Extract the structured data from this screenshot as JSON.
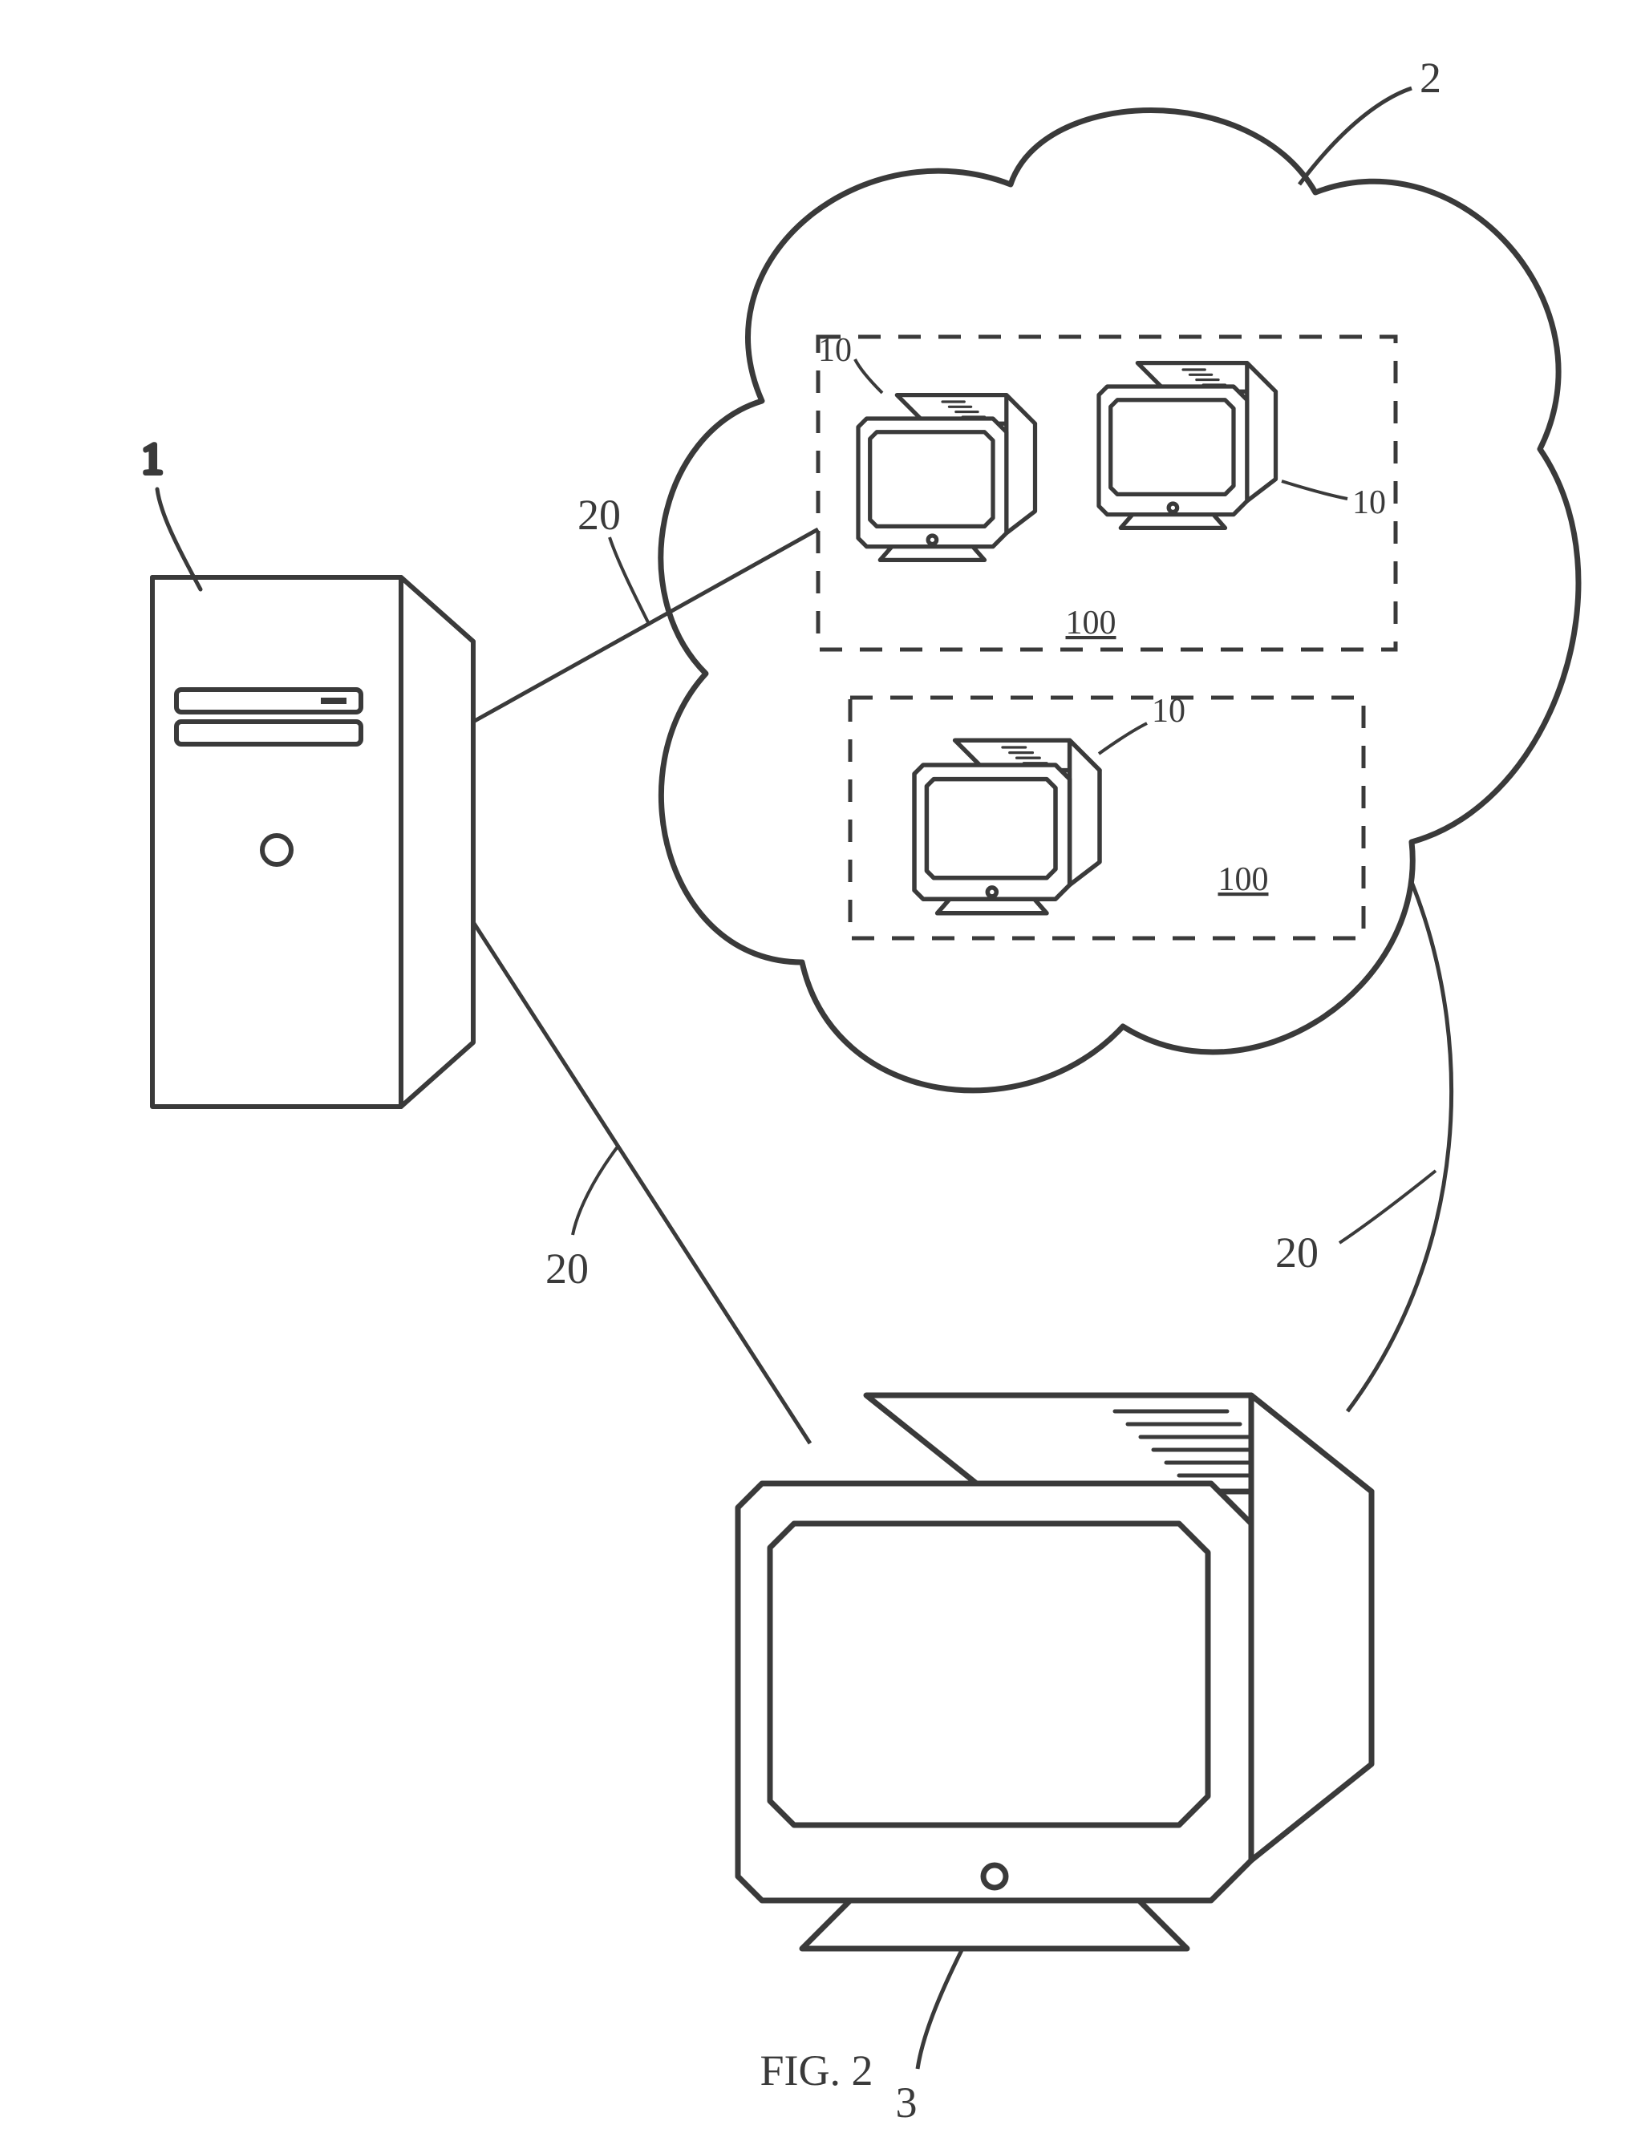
{
  "caption": "FIG. 2",
  "refs": {
    "server": "1",
    "cloud": "2",
    "client": "3",
    "vm_tl": "10",
    "vm_tr": "10",
    "vm_b": "10",
    "group_top": "100",
    "group_bottom": "100",
    "link_a": "20",
    "link_b": "20",
    "link_c": "20"
  },
  "diagram": {
    "description": "A patent figure showing a server tower (1) connected via links (20) to a cloud (2) that contains two dashed groupings (100) of small CRT-style terminals (10), and separately connected via link (20) to a large CRT-style client terminal (3); another link (20) runs from the cloud down to the client.",
    "nodes": [
      {
        "id": "server",
        "ref": "1",
        "type": "server-tower"
      },
      {
        "id": "cloud",
        "ref": "2",
        "type": "cloud"
      },
      {
        "id": "vm-group-top",
        "ref": "100",
        "type": "dashed-box",
        "contains": [
          "vm-tl",
          "vm-tr"
        ]
      },
      {
        "id": "vm-group-bottom",
        "ref": "100",
        "type": "dashed-box",
        "contains": [
          "vm-b"
        ]
      },
      {
        "id": "vm-tl",
        "ref": "10",
        "type": "crt-terminal-small"
      },
      {
        "id": "vm-tr",
        "ref": "10",
        "type": "crt-terminal-small"
      },
      {
        "id": "vm-b",
        "ref": "10",
        "type": "crt-terminal-small"
      },
      {
        "id": "client",
        "ref": "3",
        "type": "crt-terminal-large"
      }
    ],
    "links": [
      {
        "id": "link-a",
        "ref": "20",
        "from": "server",
        "to": "cloud"
      },
      {
        "id": "link-b",
        "ref": "20",
        "from": "server",
        "to": "client"
      },
      {
        "id": "link-c",
        "ref": "20",
        "from": "cloud",
        "to": "client"
      }
    ]
  }
}
